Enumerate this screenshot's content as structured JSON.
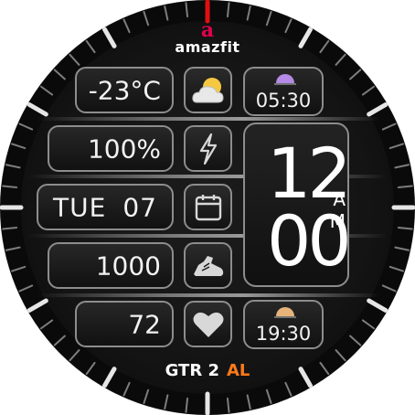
{
  "brand": {
    "logo_mark": "a",
    "logo_text": "amazfit",
    "mark_color": "#e4004f"
  },
  "weather": {
    "temperature": "-23°C",
    "icon": "partly-cloudy-icon"
  },
  "battery": {
    "value": "100%",
    "icon": "lightning-icon"
  },
  "date": {
    "weekday": "TUE",
    "day": "07",
    "icon": "calendar-icon"
  },
  "steps": {
    "value": "1000",
    "icon": "shoe-icon"
  },
  "heart": {
    "value": "72",
    "icon": "heart-icon"
  },
  "sunrise": {
    "time": "05:30",
    "icon": "sunrise-icon",
    "color": "#b48ae6"
  },
  "sunset": {
    "time": "19:30",
    "icon": "sunset-icon",
    "color": "#e6b47a"
  },
  "clock": {
    "hour": "12",
    "minute": "00",
    "ampm_a": "A",
    "ampm_m": "M"
  },
  "model": {
    "name": "GTR 2",
    "tag": "AL",
    "tag_color": "#ff7a1a"
  },
  "colors": {
    "accent_red": "#e01010",
    "box_border": "#8d8d8d",
    "background": "#141414"
  }
}
